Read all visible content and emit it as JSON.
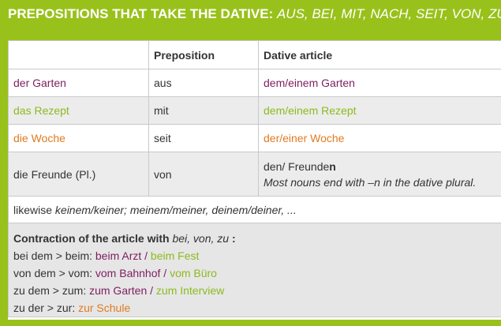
{
  "header": {
    "title_bold": "PREPOSITIONS THAT TAKE THE DATIVE:",
    "title_italic": "AUS, BEI, MIT, NACH, SEIT, VON, ZU"
  },
  "colors": {
    "background_green": "#99c11b",
    "purple": "#7d1e5f",
    "green": "#8dba1e",
    "orange": "#e07b20"
  },
  "table": {
    "columns": [
      "",
      "Preposition",
      "Dative article"
    ],
    "rows": [
      {
        "noun": "der Garten",
        "preposition": "aus",
        "article": "dem/einem Garten",
        "color": "purple"
      },
      {
        "noun": "das Rezept",
        "preposition": "mit",
        "article": "dem/einem Rezept",
        "color": "green"
      },
      {
        "noun": "die Woche",
        "preposition": "seit",
        "article": "der/einer Woche",
        "color": "orange"
      },
      {
        "noun": "die Freunde (Pl.)",
        "preposition": "von",
        "article_prefix": "den/ Freunde",
        "article_suffix": "n",
        "note": "Most nouns end with –n in the dative plural."
      }
    ]
  },
  "likewise": {
    "prefix": "likewise ",
    "words": "keinem/keiner; meinem/meiner, deinem/deiner, ..."
  },
  "contraction": {
    "heading_bold": "Contraction of the article with ",
    "heading_italic": "bei, von, zu",
    "heading_colon": " :",
    "lines": [
      {
        "rule": "bei dem > beim: ",
        "ex1": "beim Arzt",
        "sep": " / ",
        "ex2": "beim Fest",
        "c1": "purple",
        "c2": "green"
      },
      {
        "rule": "von dem > vom: ",
        "ex1": "vom Bahnhof",
        "sep": " / ",
        "ex2": "vom Büro",
        "c1": "purple",
        "c2": "green"
      },
      {
        "rule": "zu dem > zum: ",
        "ex1": "zum Garten",
        "sep": " / ",
        "ex2": "zum Interview",
        "c1": "purple",
        "c2": "green"
      },
      {
        "rule": "zu der > zur: ",
        "ex1": "zur Schule",
        "sep": "",
        "ex2": "",
        "c1": "orange",
        "c2": "orange"
      }
    ]
  }
}
